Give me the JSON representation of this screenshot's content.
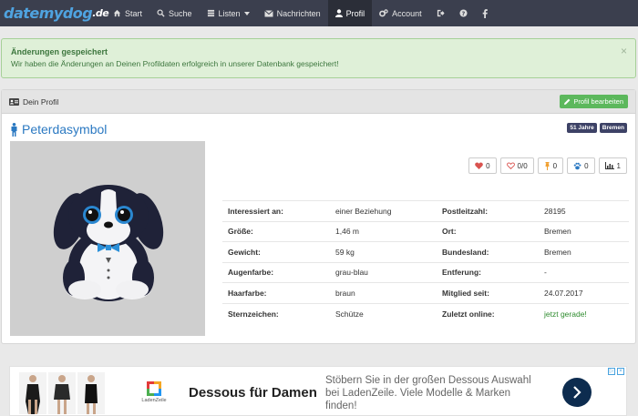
{
  "navbar": {
    "logo_main": "datemydog",
    "logo_tld": ".de",
    "items": [
      {
        "label": "Start",
        "icon": "home-icon"
      },
      {
        "label": "Suche",
        "icon": "search-icon"
      },
      {
        "label": "Listen",
        "icon": "list-icon"
      },
      {
        "label": "Nachrichten",
        "icon": "envelope-icon"
      },
      {
        "label": "Profil",
        "icon": "user-icon"
      },
      {
        "label": "Account",
        "icon": "cogs-icon"
      }
    ],
    "active": "Profil"
  },
  "alert": {
    "title": "Änderungen gespeichert",
    "text": "Wir haben die Änderungen an Deinen Profildaten erfolgreich in unserer Datenbank gespeichert!",
    "close": "×"
  },
  "panel": {
    "title": "Dein Profil",
    "edit_button": "Profil bearbeiten"
  },
  "profile": {
    "name": "Peterdasymbol",
    "age_badge": "51 Jahre",
    "city_badge": "Bremen"
  },
  "stats": {
    "likes": "0",
    "hearts": "0/0",
    "favorites": "0",
    "paws": "0",
    "views": "1"
  },
  "info_rows": [
    {
      "l1": "Interessiert an:",
      "v1": "einer Beziehung",
      "l2": "Postleitzahl:",
      "v2": "28195"
    },
    {
      "l1": "Größe:",
      "v1": "1,46 m",
      "l2": "Ort:",
      "v2": "Bremen"
    },
    {
      "l1": "Gewicht:",
      "v1": "59 kg",
      "l2": "Bundesland:",
      "v2": "Bremen"
    },
    {
      "l1": "Augenfarbe:",
      "v1": "grau-blau",
      "l2": "Entferung:",
      "v2": "-"
    },
    {
      "l1": "Haarfarbe:",
      "v1": "braun",
      "l2": "Mitglied seit:",
      "v2": "24.07.2017"
    },
    {
      "l1": "Sternzeichen:",
      "v1": "Schütze",
      "l2": "Zuletzt online:",
      "v2": "jetzt gerade!"
    }
  ],
  "ad": {
    "logo_text": "LadenZeile",
    "headline": "Dessous für Damen",
    "description": "Stöbern Sie in der großen Dessous Auswahl bei LadenZeile. Viele Modelle & Marken finden!"
  },
  "colors": {
    "navbar": "#3b3f4e",
    "accent_blue": "#2b79c2",
    "success": "#5cb85c",
    "badge": "#3d4266"
  }
}
